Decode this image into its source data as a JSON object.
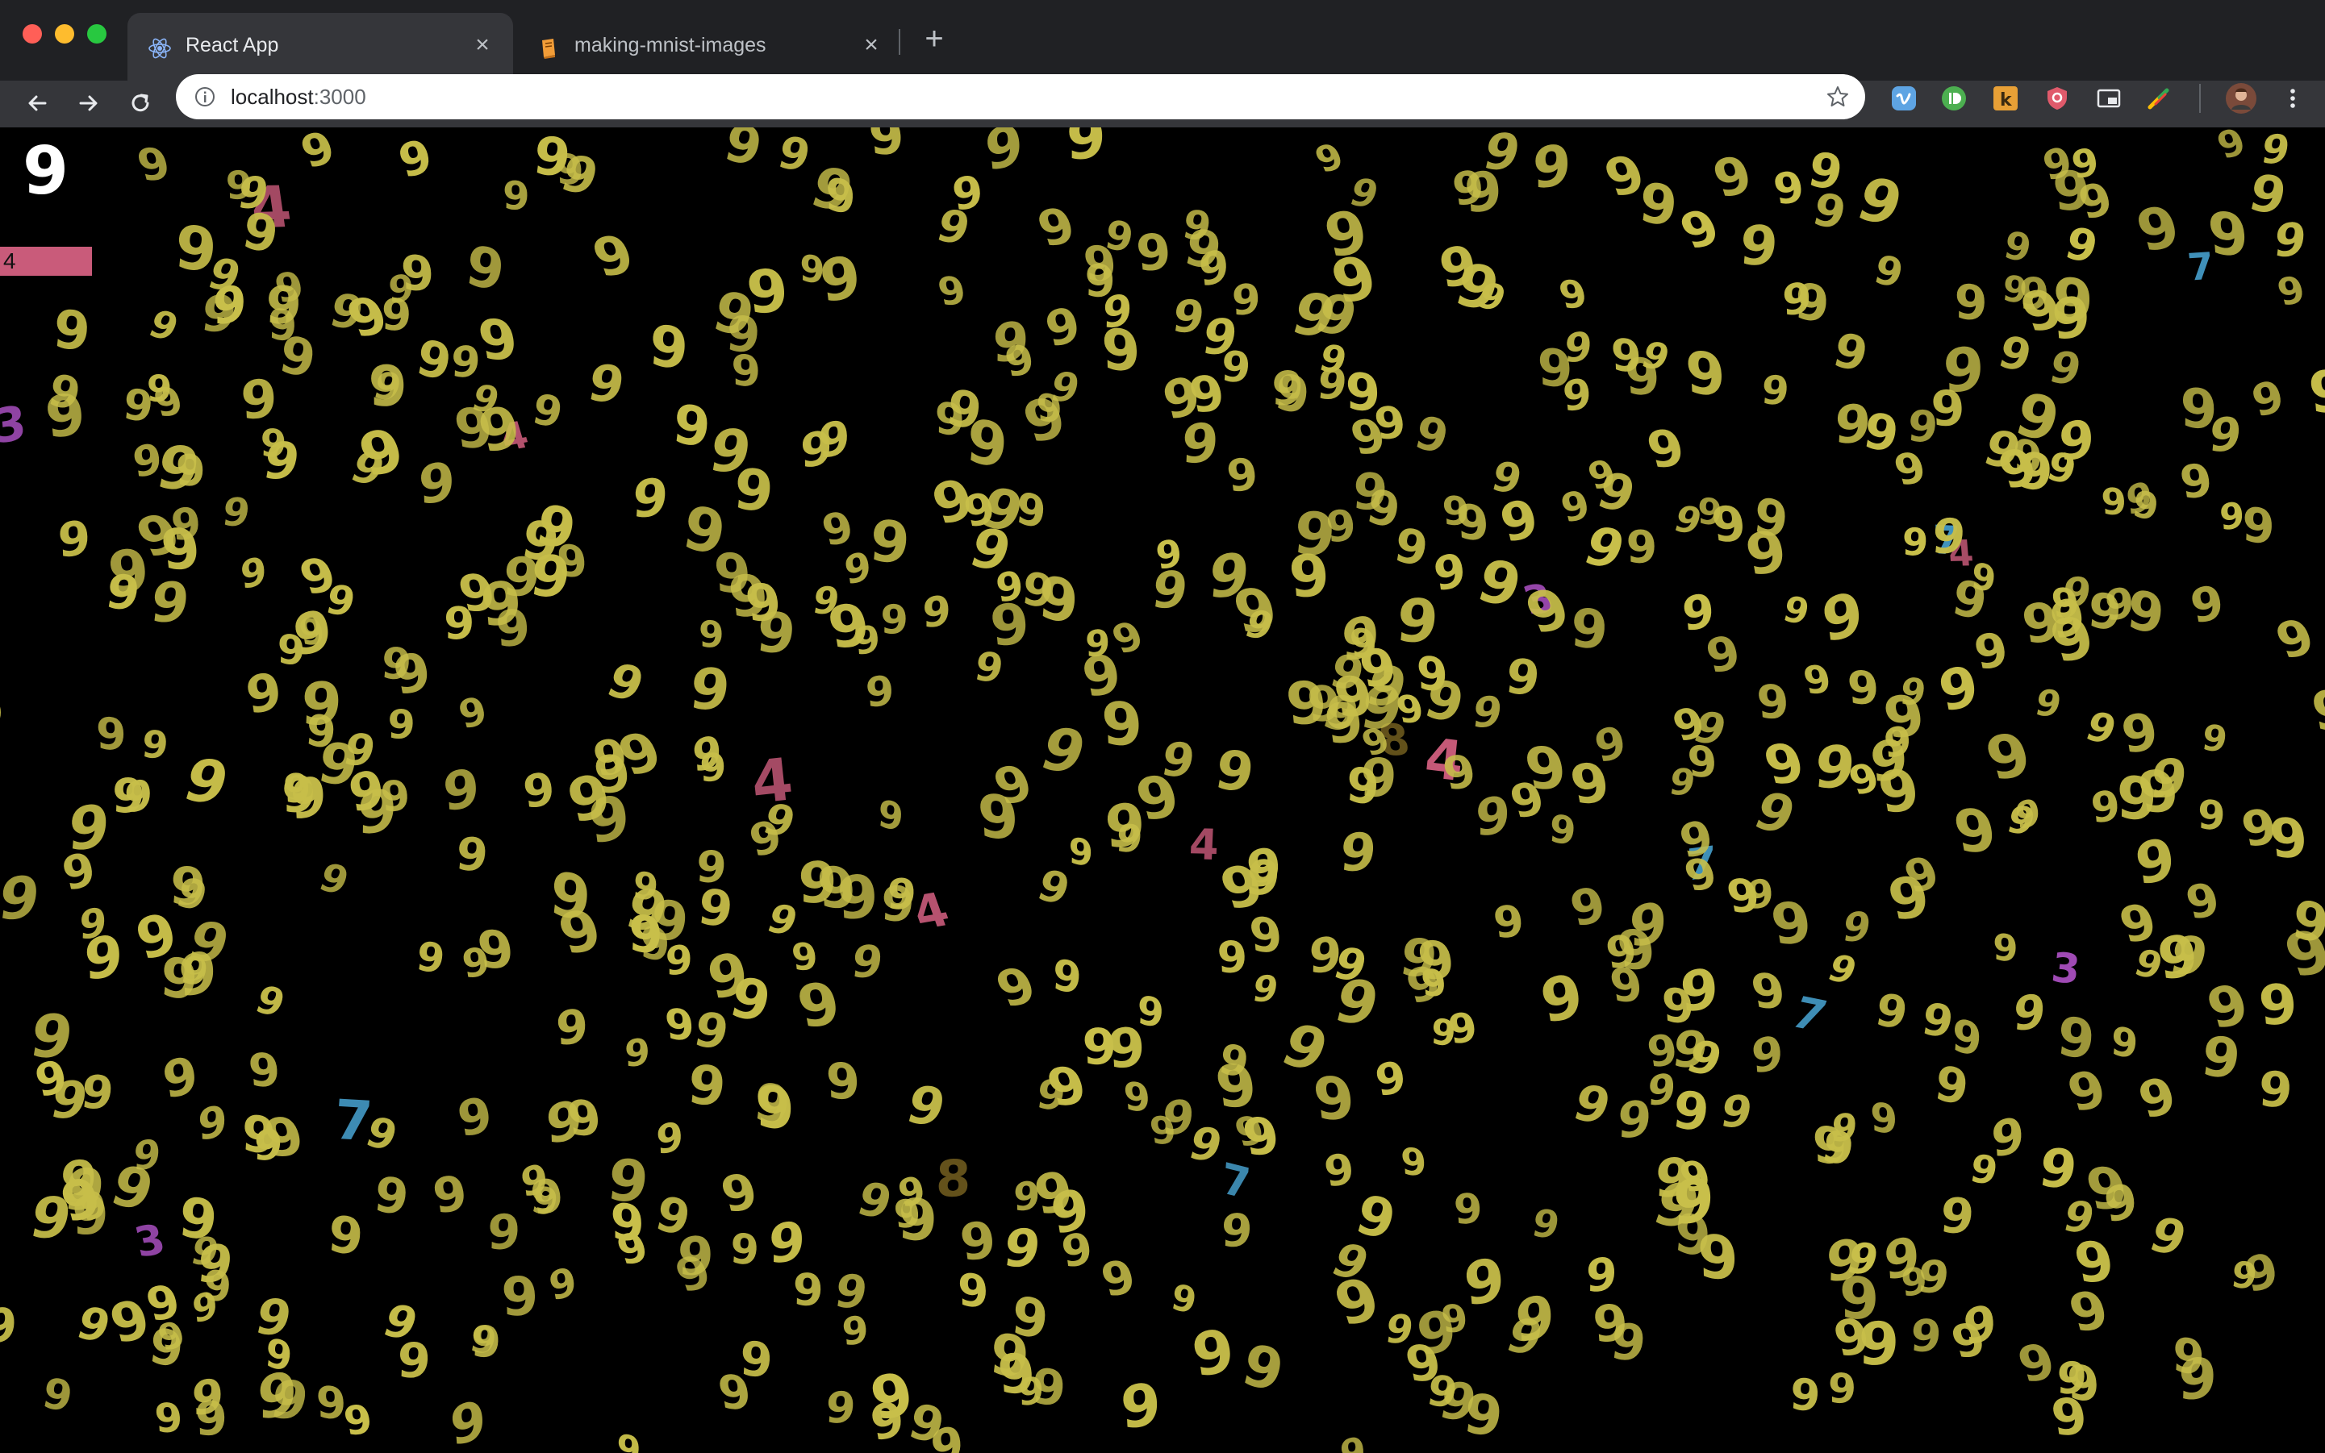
{
  "browser": {
    "tabs": [
      {
        "title": "React App",
        "favicon": "react-icon",
        "active": true
      },
      {
        "title": "making-mnist-images",
        "favicon": "book-icon",
        "active": false
      }
    ],
    "address": {
      "host": "localhost",
      "port": ":3000"
    },
    "extensions": [
      "vimeo-icon",
      "pushbullet-icon",
      "k-extension-icon",
      "shield-extension-icon",
      "picture-in-picture-icon",
      "color-picker-icon",
      "profile-avatar"
    ]
  },
  "page": {
    "current_digit": "9",
    "prediction": "4",
    "digit_glyphs": [
      "9",
      "4",
      "7",
      "3",
      "8"
    ],
    "colors": {
      "background": "#000000",
      "digit_9": "#c8bf4a",
      "digit_4": "#c95b7a",
      "digit_7": "#4aa8d8",
      "digit_3": "#a94fc0",
      "digit_8": "#6e5a1e",
      "prediction_bar": "#c95b7a"
    },
    "digit_counts": {
      "9": 700,
      "4": 7,
      "7": 6,
      "3": 4,
      "8": 3
    }
  }
}
